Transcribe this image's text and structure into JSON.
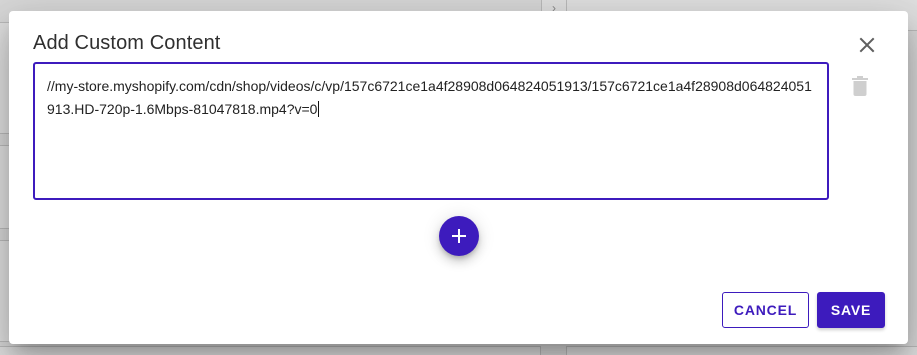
{
  "dialog": {
    "title": "Add Custom Content",
    "content_value": "//my-store.myshopify.com/cdn/shop/videos/c/vp/157c6721ce1a4f28908d064824051913/157c6721ce1a4f28908d064824051913.HD-720p-1.6Mbps-81047818.mp4?v=0",
    "cancel_label": "CANCEL",
    "save_label": "SAVE"
  },
  "icons": {
    "close": "close-icon",
    "delete": "trash-icon",
    "add": "plus-icon"
  },
  "colors": {
    "accent": "#3d1bbd",
    "disabled_icon": "#cfcfcf",
    "close_icon": "#5f5f5f"
  }
}
